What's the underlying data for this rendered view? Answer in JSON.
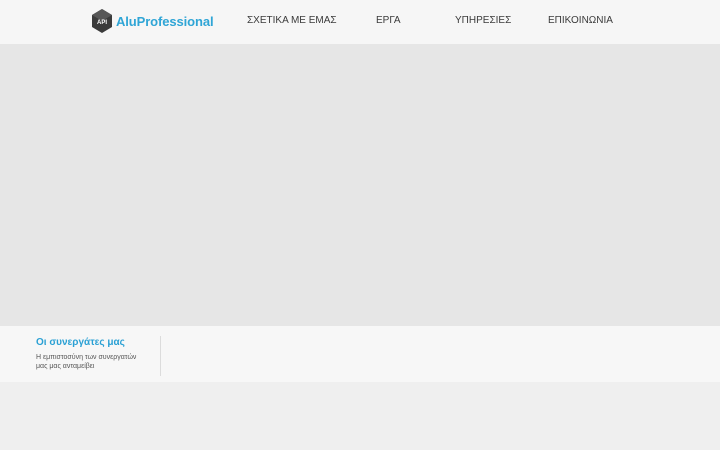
{
  "brand": {
    "logo_initials": "API",
    "name": "AluProfessional",
    "accent": "#2fa5d6"
  },
  "nav": {
    "about": "ΣΧΕΤΙΚΑ ΜΕ ΕΜΑΣ",
    "projects": "ΕΡΓΑ",
    "services": "ΥΠΗΡΕΣΙΕΣ",
    "contact": "ΕΠΙΚΟΙΝΩΝΙΑ"
  },
  "partners": {
    "title": "Οι συνεργάτες μας",
    "description": "Η εμπιστοσύνη των συνεργατών μας μας ανταμείβει"
  }
}
